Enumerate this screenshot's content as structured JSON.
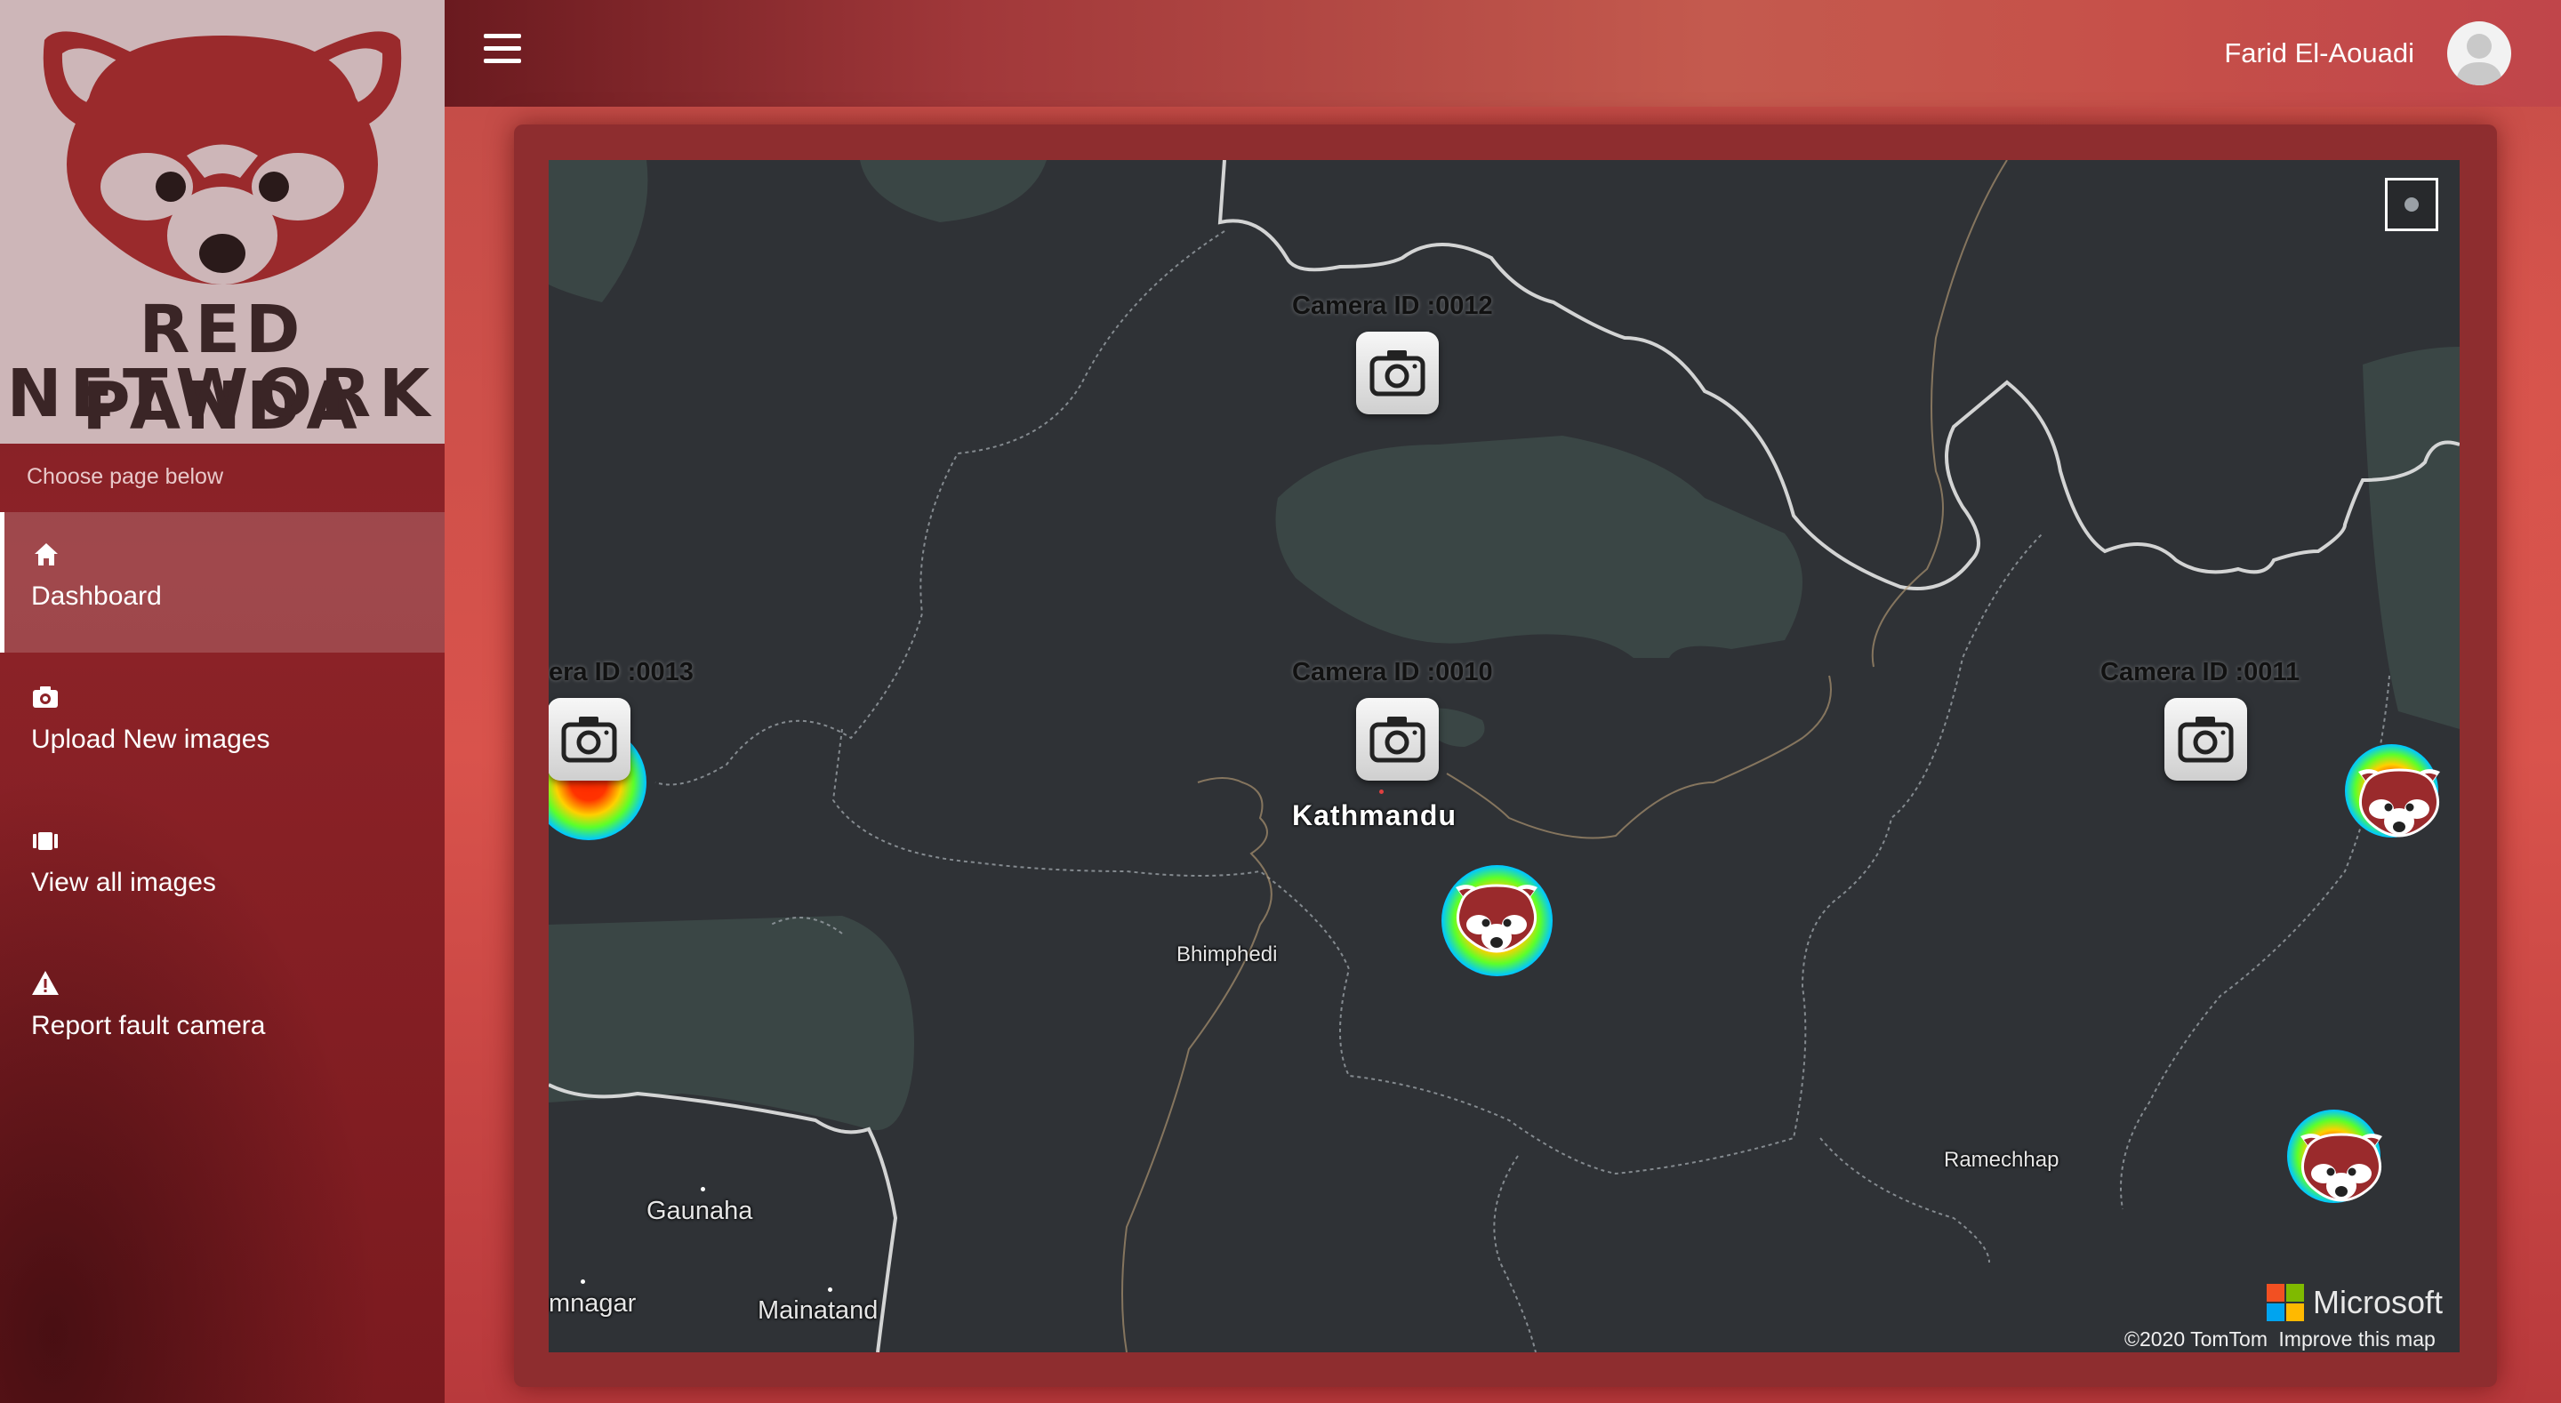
{
  "sidebar": {
    "logo": {
      "line1": "RED PANDA",
      "line2": "NETWORK"
    },
    "caption": "Choose page below",
    "items": [
      {
        "label": "Dashboard",
        "icon": "home-icon",
        "active": true
      },
      {
        "label": "Upload New images",
        "icon": "camera-plus-icon"
      },
      {
        "label": "View all images",
        "icon": "gallery-icon"
      },
      {
        "label": "Report fault camera",
        "icon": "warning-icon"
      }
    ]
  },
  "header": {
    "user_name": "Farid El-Aouadi",
    "menu_icon": "hamburger-icon",
    "avatar_icon": "avatar-icon"
  },
  "map": {
    "cameras": [
      {
        "label": "Camera ID :0012",
        "icon": "camera-icon"
      },
      {
        "label": "Camera ID :0010",
        "icon": "camera-icon"
      },
      {
        "label": "Camera ID :0011",
        "icon": "camera-icon"
      },
      {
        "label": "era ID :0013",
        "icon": "camera-icon"
      }
    ],
    "places": {
      "kathmandu": "Kathmandu",
      "bhimphedi": "Bhimphedi",
      "ramechhap": "Ramechhap",
      "gaunaha": "Gaunaha",
      "mnagar": "mnagar",
      "mainatand": "Mainatand"
    },
    "brand": "Microsoft",
    "copyright": "©2020 TomTom",
    "improve": "Improve this map",
    "colors": {
      "map_bg": "#2f3236",
      "land_green": "#3a4645",
      "border": "#e6e6e6",
      "accent": "#8e2d2f"
    }
  }
}
